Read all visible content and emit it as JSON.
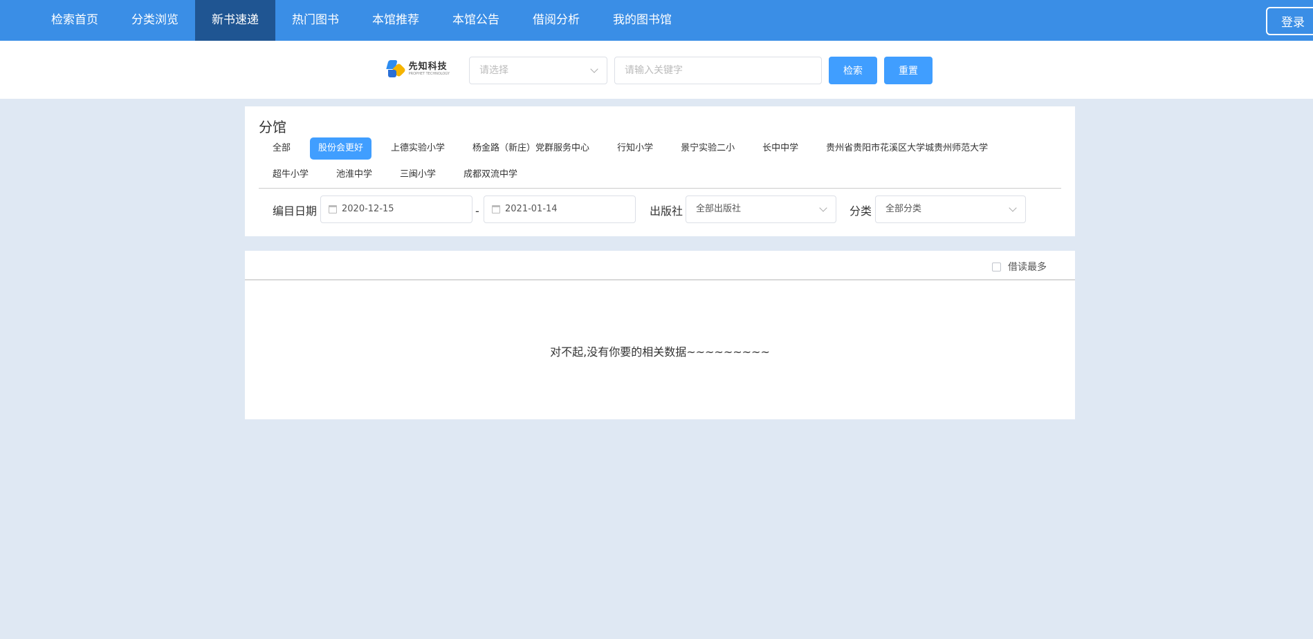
{
  "nav": {
    "items": [
      "检索首页",
      "分类浏览",
      "新书速递",
      "热门图书",
      "本馆推荐",
      "本馆公告",
      "借阅分析",
      "我的图书馆"
    ],
    "active_index": 2,
    "login_label": "登录"
  },
  "search": {
    "logo_cn": "先知科技",
    "logo_en": "PROPHET TECHNOLOGY",
    "select_placeholder": "请选择",
    "keyword_placeholder": "请输入关键字",
    "search_label": "检索",
    "reset_label": "重置"
  },
  "filters": {
    "section_title": "分馆",
    "branches": [
      "全部",
      "股份会更好",
      "上德实验小学",
      "杨金路（新庄）党群服务中心",
      "行知小学",
      "景宁实验二小",
      "长中中学",
      "贵州省贵阳市花溪区大学城贵州师范大学",
      "超牛小学",
      "池淮中学",
      "三闽小学",
      "成都双流中学"
    ],
    "active_branch_index": 1,
    "date_label": "编目日期",
    "date_start": "2020-12-15",
    "date_separator": "-",
    "date_end": "2021-01-14",
    "publisher_label": "出版社",
    "publisher_value": "全部出版社",
    "category_label": "分类",
    "category_value": "全部分类"
  },
  "results": {
    "sort_label": "借读最多",
    "empty_message": "对不起,没有你要的相关数据~~~~~~~~~"
  },
  "colors": {
    "nav_bg": "#3a8ee6",
    "nav_active": "#1f5592",
    "primary": "#409eff",
    "page_bg": "#dfe8f3"
  }
}
